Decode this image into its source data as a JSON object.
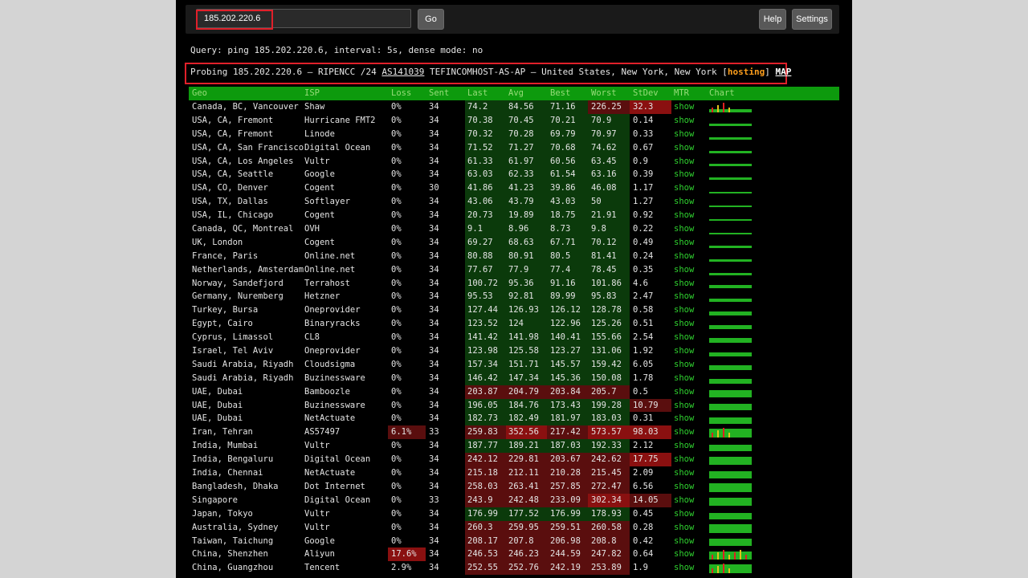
{
  "toolbar": {
    "search_value": "185.202.220.6",
    "go_label": "Go",
    "help_label": "Help",
    "settings_label": "Settings"
  },
  "query_text": "Query: ping 185.202.220.6, interval: 5s, dense mode: no",
  "probe": {
    "prefix": "Probing 185.202.220.6 — RIPENCC /24 ",
    "as": "AS141039",
    "middle": " TEFINCOMHOST-AS-AP — United States, New York, New York [",
    "hosting": "hosting",
    "close": "] ",
    "map": "MAP"
  },
  "colors": {
    "header_bg": "#0d9a0d",
    "good_bg": "#0b3a0b",
    "bad_bg": "#5a0e0e",
    "worse_bg": "#8a1010",
    "mtr_link": "#2fd12f",
    "hosting_tag": "#ff9f1c",
    "highlight_box": "#e0202a"
  },
  "table": {
    "headers": [
      "Geo",
      "ISP",
      "Loss",
      "Sent",
      "Last",
      "Avg",
      "Best",
      "Worst",
      "StDev",
      "MTR",
      "Chart"
    ],
    "rows": [
      {
        "geo": "Canada, BC, Vancouver",
        "isp": "Shaw",
        "loss": "0%",
        "sent": "34",
        "last": "74.2",
        "avg": "84.56",
        "best": "71.16",
        "worst": "226.25",
        "stdev": "32.3",
        "mtr": "show"
      },
      {
        "geo": "USA, CA, Fremont",
        "isp": "Hurricane FMT2",
        "loss": "0%",
        "sent": "34",
        "last": "70.38",
        "avg": "70.45",
        "best": "70.21",
        "worst": "70.9",
        "stdev": "0.14",
        "mtr": "show"
      },
      {
        "geo": "USA, CA, Fremont",
        "isp": "Linode",
        "loss": "0%",
        "sent": "34",
        "last": "70.32",
        "avg": "70.28",
        "best": "69.79",
        "worst": "70.97",
        "stdev": "0.33",
        "mtr": "show"
      },
      {
        "geo": "USA, CA, San Francisco",
        "isp": "Digital Ocean",
        "loss": "0%",
        "sent": "34",
        "last": "71.52",
        "avg": "71.27",
        "best": "70.68",
        "worst": "74.62",
        "stdev": "0.67",
        "mtr": "show"
      },
      {
        "geo": "USA, CA, Los Angeles",
        "isp": "Vultr",
        "loss": "0%",
        "sent": "34",
        "last": "61.33",
        "avg": "61.97",
        "best": "60.56",
        "worst": "63.45",
        "stdev": "0.9",
        "mtr": "show"
      },
      {
        "geo": "USA, CA, Seattle",
        "isp": "Google",
        "loss": "0%",
        "sent": "34",
        "last": "63.03",
        "avg": "62.33",
        "best": "61.54",
        "worst": "63.16",
        "stdev": "0.39",
        "mtr": "show"
      },
      {
        "geo": "USA, CO, Denver",
        "isp": "Cogent",
        "loss": "0%",
        "sent": "30",
        "last": "41.86",
        "avg": "41.23",
        "best": "39.86",
        "worst": "46.08",
        "stdev": "1.17",
        "mtr": "show"
      },
      {
        "geo": "USA, TX, Dallas",
        "isp": "Softlayer",
        "loss": "0%",
        "sent": "34",
        "last": "43.06",
        "avg": "43.79",
        "best": "43.03",
        "worst": "50",
        "stdev": "1.27",
        "mtr": "show"
      },
      {
        "geo": "USA, IL, Chicago",
        "isp": "Cogent",
        "loss": "0%",
        "sent": "34",
        "last": "20.73",
        "avg": "19.89",
        "best": "18.75",
        "worst": "21.91",
        "stdev": "0.92",
        "mtr": "show"
      },
      {
        "geo": "Canada, QC, Montreal",
        "isp": "OVH",
        "loss": "0%",
        "sent": "34",
        "last": "9.1",
        "avg": "8.96",
        "best": "8.73",
        "worst": "9.8",
        "stdev": "0.22",
        "mtr": "show"
      },
      {
        "geo": "UK, London",
        "isp": "Cogent",
        "loss": "0%",
        "sent": "34",
        "last": "69.27",
        "avg": "68.63",
        "best": "67.71",
        "worst": "70.12",
        "stdev": "0.49",
        "mtr": "show"
      },
      {
        "geo": "France, Paris",
        "isp": "Online.net",
        "loss": "0%",
        "sent": "34",
        "last": "80.88",
        "avg": "80.91",
        "best": "80.5",
        "worst": "81.41",
        "stdev": "0.24",
        "mtr": "show"
      },
      {
        "geo": "Netherlands, Amsterdam",
        "isp": "Online.net",
        "loss": "0%",
        "sent": "34",
        "last": "77.67",
        "avg": "77.9",
        "best": "77.4",
        "worst": "78.45",
        "stdev": "0.35",
        "mtr": "show"
      },
      {
        "geo": "Norway, Sandefjord",
        "isp": "Terrahost",
        "loss": "0%",
        "sent": "34",
        "last": "100.72",
        "avg": "95.36",
        "best": "91.16",
        "worst": "101.86",
        "stdev": "4.6",
        "mtr": "show"
      },
      {
        "geo": "Germany, Nuremberg",
        "isp": "Hetzner",
        "loss": "0%",
        "sent": "34",
        "last": "95.53",
        "avg": "92.81",
        "best": "89.99",
        "worst": "95.83",
        "stdev": "2.47",
        "mtr": "show"
      },
      {
        "geo": "Turkey, Bursa",
        "isp": "Oneprovider",
        "loss": "0%",
        "sent": "34",
        "last": "127.44",
        "avg": "126.93",
        "best": "126.12",
        "worst": "128.78",
        "stdev": "0.58",
        "mtr": "show"
      },
      {
        "geo": "Egypt, Cairo",
        "isp": "Binaryracks",
        "loss": "0%",
        "sent": "34",
        "last": "123.52",
        "avg": "124",
        "best": "122.96",
        "worst": "125.26",
        "stdev": "0.51",
        "mtr": "show"
      },
      {
        "geo": "Cyprus, Limassol",
        "isp": "CL8",
        "loss": "0%",
        "sent": "34",
        "last": "141.42",
        "avg": "141.98",
        "best": "140.41",
        "worst": "155.66",
        "stdev": "2.54",
        "mtr": "show"
      },
      {
        "geo": "Israel, Tel Aviv",
        "isp": "Oneprovider",
        "loss": "0%",
        "sent": "34",
        "last": "123.98",
        "avg": "125.58",
        "best": "123.27",
        "worst": "131.06",
        "stdev": "1.92",
        "mtr": "show"
      },
      {
        "geo": "Saudi Arabia, Riyadh",
        "isp": "Cloudsigma",
        "loss": "0%",
        "sent": "34",
        "last": "157.34",
        "avg": "151.71",
        "best": "145.57",
        "worst": "159.42",
        "stdev": "6.05",
        "mtr": "show"
      },
      {
        "geo": "Saudi Arabia, Riyadh",
        "isp": "Buzinessware",
        "loss": "0%",
        "sent": "34",
        "last": "146.42",
        "avg": "147.34",
        "best": "145.36",
        "worst": "150.08",
        "stdev": "1.78",
        "mtr": "show"
      },
      {
        "geo": "UAE, Dubai",
        "isp": "Bamboozle",
        "loss": "0%",
        "sent": "34",
        "last": "203.87",
        "avg": "204.79",
        "best": "203.84",
        "worst": "205.7",
        "stdev": "0.5",
        "mtr": "show"
      },
      {
        "geo": "UAE, Dubai",
        "isp": "Buzinessware",
        "loss": "0%",
        "sent": "34",
        "last": "196.05",
        "avg": "184.76",
        "best": "173.43",
        "worst": "199.28",
        "stdev": "10.79",
        "mtr": "show"
      },
      {
        "geo": "UAE, Dubai",
        "isp": "NetActuate",
        "loss": "0%",
        "sent": "34",
        "last": "182.73",
        "avg": "182.49",
        "best": "181.97",
        "worst": "183.03",
        "stdev": "0.31",
        "mtr": "show"
      },
      {
        "geo": "Iran, Tehran",
        "isp": "AS57497",
        "loss": "6.1%",
        "sent": "33",
        "last": "259.83",
        "avg": "352.56",
        "best": "217.42",
        "worst": "573.57",
        "stdev": "98.03",
        "mtr": "show"
      },
      {
        "geo": "India, Mumbai",
        "isp": "Vultr",
        "loss": "0%",
        "sent": "34",
        "last": "187.77",
        "avg": "189.21",
        "best": "187.03",
        "worst": "192.33",
        "stdev": "2.12",
        "mtr": "show"
      },
      {
        "geo": "India, Bengaluru",
        "isp": "Digital Ocean",
        "loss": "0%",
        "sent": "34",
        "last": "242.12",
        "avg": "229.81",
        "best": "203.67",
        "worst": "242.62",
        "stdev": "17.75",
        "mtr": "show"
      },
      {
        "geo": "India, Chennai",
        "isp": "NetActuate",
        "loss": "0%",
        "sent": "34",
        "last": "215.18",
        "avg": "212.11",
        "best": "210.28",
        "worst": "215.45",
        "stdev": "2.09",
        "mtr": "show"
      },
      {
        "geo": "Bangladesh, Dhaka",
        "isp": "Dot Internet",
        "loss": "0%",
        "sent": "34",
        "last": "258.03",
        "avg": "263.41",
        "best": "257.85",
        "worst": "272.47",
        "stdev": "6.56",
        "mtr": "show"
      },
      {
        "geo": "Singapore",
        "isp": "Digital Ocean",
        "loss": "0%",
        "sent": "33",
        "last": "243.9",
        "avg": "242.48",
        "best": "233.09",
        "worst": "302.34",
        "stdev": "14.05",
        "mtr": "show"
      },
      {
        "geo": "Japan, Tokyo",
        "isp": "Vultr",
        "loss": "0%",
        "sent": "34",
        "last": "176.99",
        "avg": "177.52",
        "best": "176.99",
        "worst": "178.93",
        "stdev": "0.45",
        "mtr": "show"
      },
      {
        "geo": "Australia, Sydney",
        "isp": "Vultr",
        "loss": "0%",
        "sent": "34",
        "last": "260.3",
        "avg": "259.95",
        "best": "259.51",
        "worst": "260.58",
        "stdev": "0.28",
        "mtr": "show"
      },
      {
        "geo": "Taiwan, Taichung",
        "isp": "Google",
        "loss": "0%",
        "sent": "34",
        "last": "208.17",
        "avg": "207.8",
        "best": "206.98",
        "worst": "208.8",
        "stdev": "0.42",
        "mtr": "show"
      },
      {
        "geo": "China, Shenzhen",
        "isp": "Aliyun",
        "loss": "17.6%",
        "sent": "34",
        "last": "246.53",
        "avg": "246.23",
        "best": "244.59",
        "worst": "247.82",
        "stdev": "0.64",
        "mtr": "show"
      },
      {
        "geo": "China, Guangzhou",
        "isp": "Tencent",
        "loss": "2.9%",
        "sent": "34",
        "last": "252.55",
        "avg": "252.76",
        "best": "242.19",
        "worst": "253.89",
        "stdev": "1.9",
        "mtr": "show"
      }
    ]
  }
}
